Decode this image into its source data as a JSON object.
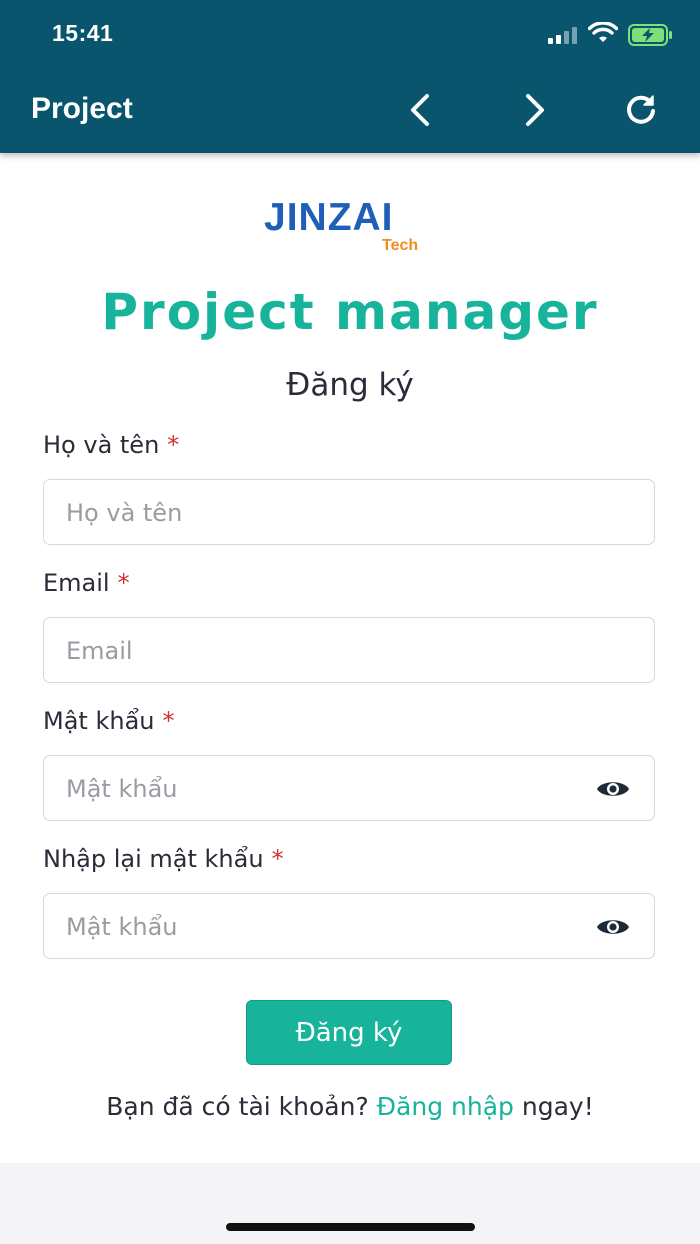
{
  "status_bar": {
    "time": "15:41"
  },
  "header": {
    "title": "Project",
    "icons": [
      "chevron-left-icon",
      "chevron-right-icon",
      "refresh-icon"
    ]
  },
  "logo": {
    "main": "JINZAI",
    "sub": "Tech"
  },
  "page": {
    "title": "Project manager",
    "subtitle": "Đăng ký"
  },
  "form": {
    "required_mark": "*",
    "fields": [
      {
        "label": "Họ và tên",
        "placeholder": "Họ và tên",
        "value": ""
      },
      {
        "label": "Email",
        "placeholder": "Email",
        "value": ""
      },
      {
        "label": "Mật khẩu",
        "placeholder": "Mật khẩu",
        "value": ""
      },
      {
        "label": "Nhập lại mật khẩu",
        "placeholder": "Mật khẩu",
        "value": ""
      }
    ],
    "submit_label": "Đăng ký"
  },
  "footer": {
    "prefix": "Bạn đã có tài khoản?",
    "link": "Đăng nhập",
    "suffix": "ngay!"
  },
  "colors": {
    "header_bg": "#0a556e",
    "accent": "#17b39a",
    "required": "#d32f2f",
    "logo_blue": "#1f5fb8",
    "logo_orange": "#f28c1e"
  }
}
